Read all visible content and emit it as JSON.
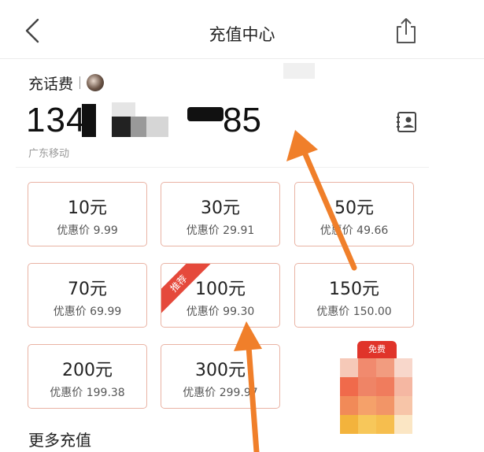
{
  "nav": {
    "title": "充值中心",
    "back_icon": "chevron-left-icon",
    "share_icon": "share-icon"
  },
  "topup": {
    "label": "充话费",
    "phone_prefix": "134",
    "phone_suffix": "85",
    "carrier": "广东移动",
    "contacts_icon": "contacts-icon"
  },
  "options": [
    {
      "amount": "10元",
      "price": "优惠价 9.99"
    },
    {
      "amount": "30元",
      "price": "优惠价 29.91"
    },
    {
      "amount": "50元",
      "price": "优惠价 49.66"
    },
    {
      "amount": "70元",
      "price": "优惠价 69.99"
    },
    {
      "amount": "100元",
      "price": "优惠价 99.30",
      "badge": "推荐"
    },
    {
      "amount": "150元",
      "price": "优惠价 150.00"
    },
    {
      "amount": "200元",
      "price": "优惠价 199.38"
    },
    {
      "amount": "300元",
      "price": "优惠价 299.97"
    }
  ],
  "more": {
    "label": "更多充值"
  },
  "ad": {
    "label": "免费"
  },
  "colors": {
    "accent": "#e5493b",
    "card_border": "#e9b3a4",
    "arrow": "#f07f2a"
  }
}
